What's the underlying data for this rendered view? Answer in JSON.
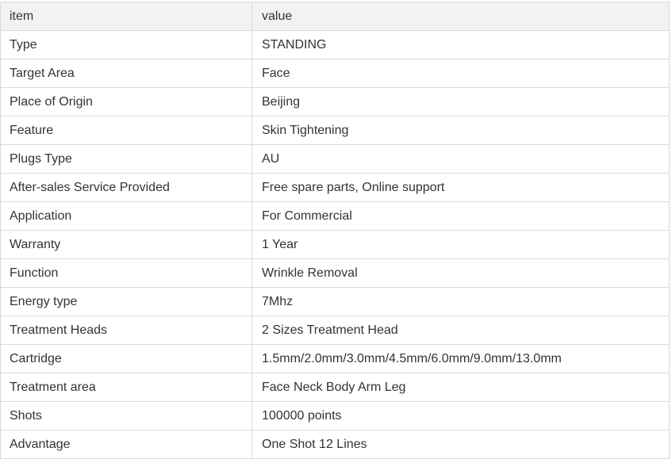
{
  "table": {
    "headers": [
      "item",
      "value"
    ],
    "rows": [
      [
        "Type",
        "STANDING"
      ],
      [
        "Target Area",
        "Face"
      ],
      [
        "Place of Origin",
        "Beijing"
      ],
      [
        "Feature",
        "Skin Tightening"
      ],
      [
        "Plugs Type",
        "AU"
      ],
      [
        "After-sales Service Provided",
        "Free spare parts, Online support"
      ],
      [
        "Application",
        "For Commercial"
      ],
      [
        "Warranty",
        "1 Year"
      ],
      [
        "Function",
        "Wrinkle Removal"
      ],
      [
        "Energy type",
        "7Mhz"
      ],
      [
        "Treatment Heads",
        "2 Sizes Treatment Head"
      ],
      [
        "Cartridge",
        "1.5mm/2.0mm/3.0mm/4.5mm/6.0mm/9.0mm/13.0mm"
      ],
      [
        "Treatment area",
        "Face Neck Body Arm Leg"
      ],
      [
        "Shots",
        "100000 points"
      ],
      [
        "Advantage",
        "One Shot 12 Lines"
      ]
    ]
  }
}
